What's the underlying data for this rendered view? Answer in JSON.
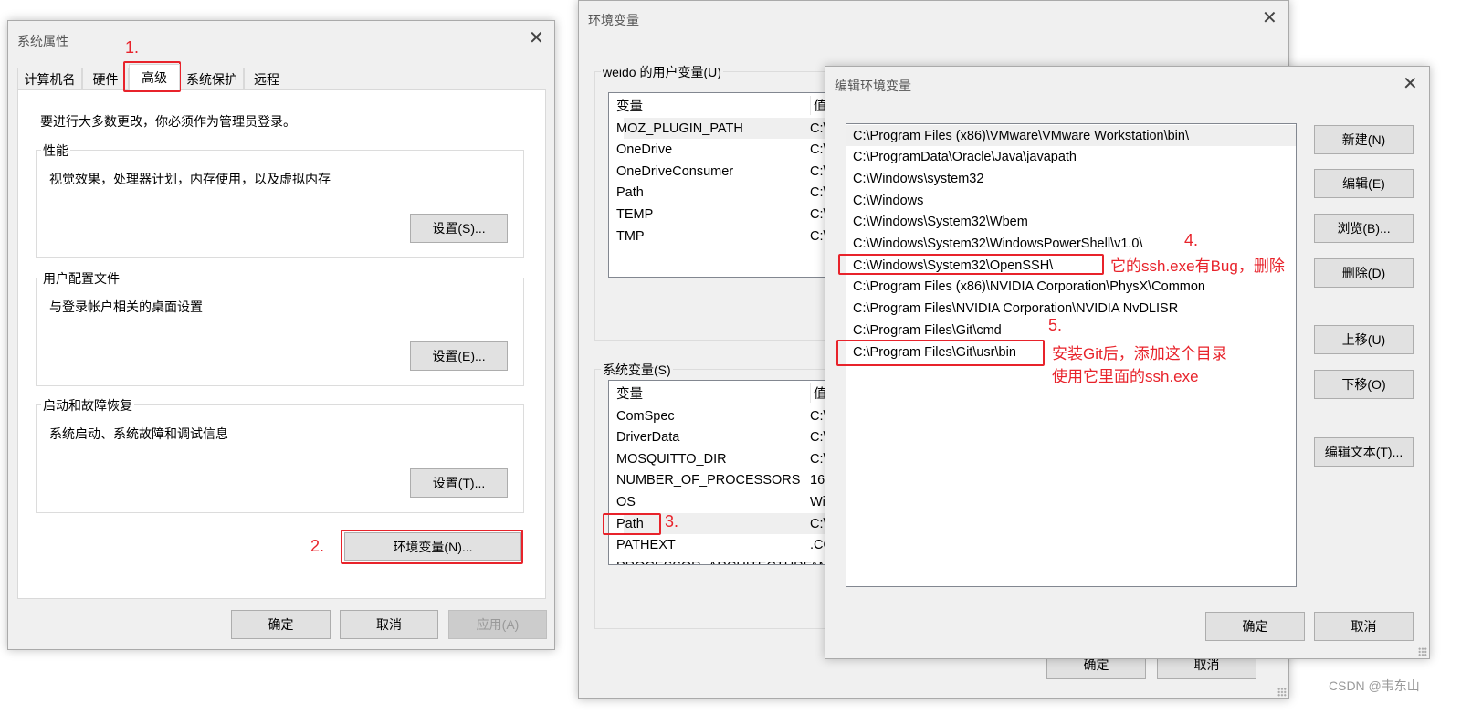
{
  "sys_props": {
    "title": "系统属性",
    "tabs": [
      "计算机名",
      "硬件",
      "高级",
      "系统保护",
      "远程"
    ],
    "active_tab": "高级",
    "admin_note": "要进行大多数更改，你必须作为管理员登录。",
    "groups": [
      {
        "label": "性能",
        "desc": "视觉效果，处理器计划，内存使用，以及虚拟内存",
        "button": "设置(S)..."
      },
      {
        "label": "用户配置文件",
        "desc": "与登录帐户相关的桌面设置",
        "button": "设置(E)..."
      },
      {
        "label": "启动和故障恢复",
        "desc": "系统启动、系统故障和调试信息",
        "button": "设置(T)..."
      }
    ],
    "env_button": "环境变量(N)...",
    "ok": "确定",
    "cancel": "取消",
    "apply": "应用(A)"
  },
  "env_vars": {
    "title": "环境变量",
    "user_group": "weido 的用户变量(U)",
    "system_group": "系统变量(S)",
    "col_var": "变量",
    "col_val": "值",
    "user_rows": [
      [
        "MOZ_PLUGIN_PATH",
        "C:\\"
      ],
      [
        "OneDrive",
        "C:\\"
      ],
      [
        "OneDriveConsumer",
        "C:\\"
      ],
      [
        "Path",
        "C:\\"
      ],
      [
        "TEMP",
        "C:\\"
      ],
      [
        "TMP",
        "C:\\"
      ]
    ],
    "system_rows": [
      [
        "ComSpec",
        "C:\\"
      ],
      [
        "DriverData",
        "C:\\"
      ],
      [
        "MOSQUITTO_DIR",
        "C:\\"
      ],
      [
        "NUMBER_OF_PROCESSORS",
        "16"
      ],
      [
        "OS",
        "Wi"
      ],
      [
        "Path",
        "C:\\"
      ],
      [
        "PATHEXT",
        ".CO"
      ],
      [
        "PROCESSOR_ARCHITECTURE",
        "AM"
      ]
    ],
    "ok": "确定",
    "cancel": "取消"
  },
  "edit_env": {
    "title": "编辑环境变量",
    "paths": [
      "C:\\Program Files (x86)\\VMware\\VMware Workstation\\bin\\",
      "C:\\ProgramData\\Oracle\\Java\\javapath",
      "C:\\Windows\\system32",
      "C:\\Windows",
      "C:\\Windows\\System32\\Wbem",
      "C:\\Windows\\System32\\WindowsPowerShell\\v1.0\\",
      "C:\\Windows\\System32\\OpenSSH\\",
      "C:\\Program Files (x86)\\NVIDIA Corporation\\PhysX\\Common",
      "C:\\Program Files\\NVIDIA Corporation\\NVIDIA NvDLISR",
      "C:\\Program Files\\Git\\cmd",
      " C:\\Program Files\\Git\\usr\\bin"
    ],
    "buttons": {
      "new": "新建(N)",
      "edit": "编辑(E)",
      "browse": "浏览(B)...",
      "delete": "删除(D)",
      "up": "上移(U)",
      "down": "下移(O)",
      "edit_text": "编辑文本(T)..."
    },
    "ok": "确定",
    "cancel": "取消"
  },
  "annotations": {
    "step1": "1.",
    "step2": "2.",
    "step3": "3.",
    "step4": "4.",
    "step4_note": "它的ssh.exe有Bug，删除",
    "step5": "5.",
    "step5_note1": "安装Git后，添加这个目录",
    "step5_note2": "使用它里面的ssh.exe",
    "color": "#e8232b"
  },
  "watermark": "CSDN @韦东山"
}
